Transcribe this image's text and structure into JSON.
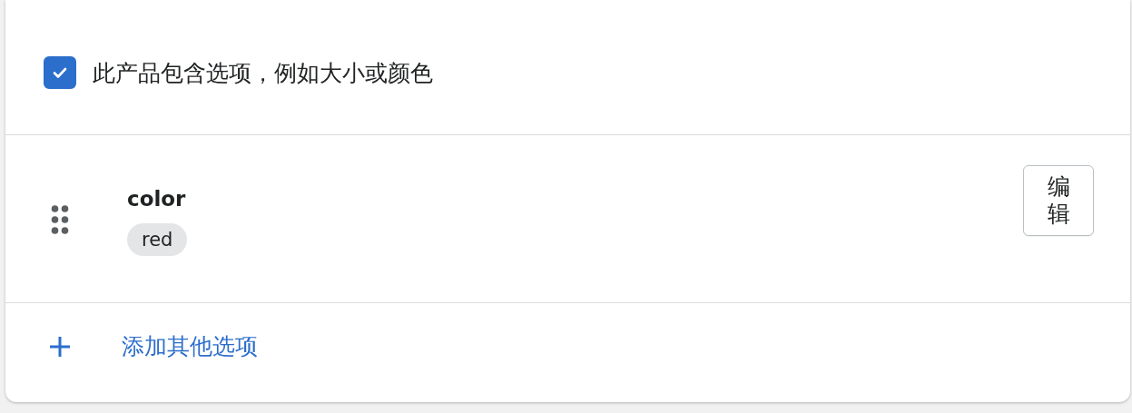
{
  "product_option_checkbox": {
    "label": "此产品包含选项，例如大小或颜色",
    "checked": true
  },
  "options": [
    {
      "name": "color",
      "values": [
        "red"
      ],
      "edit_label": "编辑"
    }
  ],
  "add_option": {
    "label": "添加其他选项"
  }
}
